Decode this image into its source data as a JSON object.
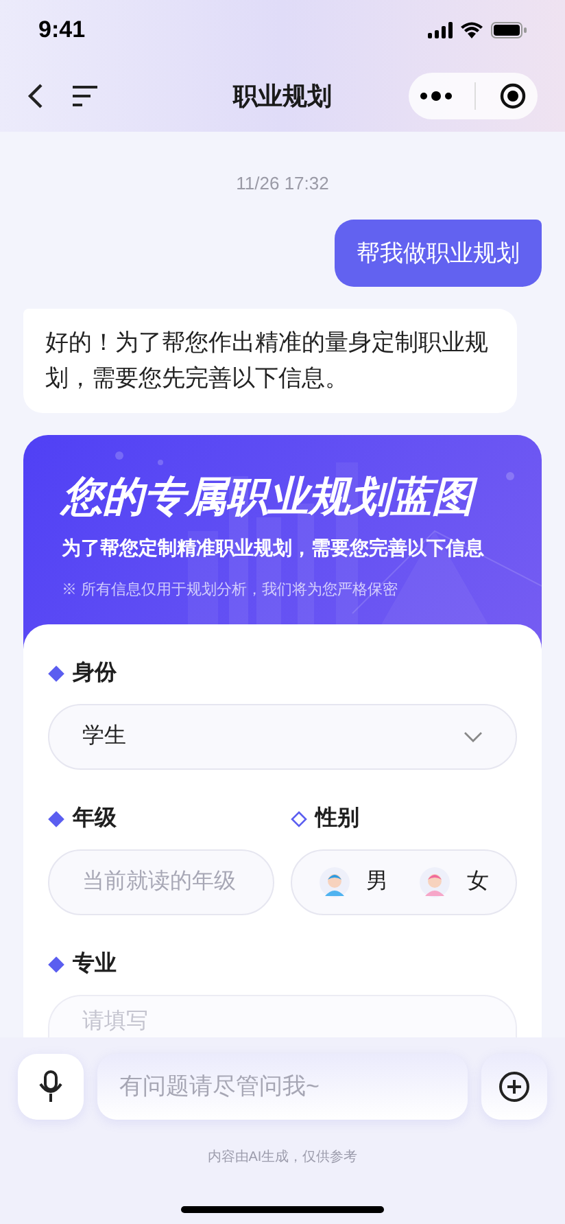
{
  "status_bar": {
    "time": "9:41"
  },
  "nav": {
    "title": "职业规划"
  },
  "timestamp": "11/26  17:32",
  "messages": [
    {
      "kind": "user",
      "text": "帮我做职业规划"
    },
    {
      "kind": "assistant",
      "text": "好的！为了帮您作出精准的量身定制职业规划，需要您先完善以下信息。"
    }
  ],
  "card": {
    "title": "您的专属职业规划蓝图",
    "subtitle": "为了帮您定制精准职业规划，需要您完善以下信息",
    "note": "※ 所有信息仅用于规划分析，我们将为您严格保密",
    "fields": [
      {
        "kind": "select",
        "label": "身份",
        "required": true,
        "value": "学生"
      },
      {
        "kind": "input",
        "label": "年级",
        "required": true,
        "placeholder": "当前就读的年级"
      },
      {
        "kind": "gender",
        "label": "性别",
        "required": false,
        "options": [
          {
            "label": "男",
            "selected": false
          },
          {
            "label": "女",
            "selected": false
          }
        ]
      },
      {
        "kind": "input",
        "label": "专业",
        "required": true,
        "placeholder": "请填写"
      }
    ]
  },
  "composer": {
    "placeholder": "有问题请尽管问我~"
  },
  "disclaimer": "内容由AI生成，仅供参考"
}
